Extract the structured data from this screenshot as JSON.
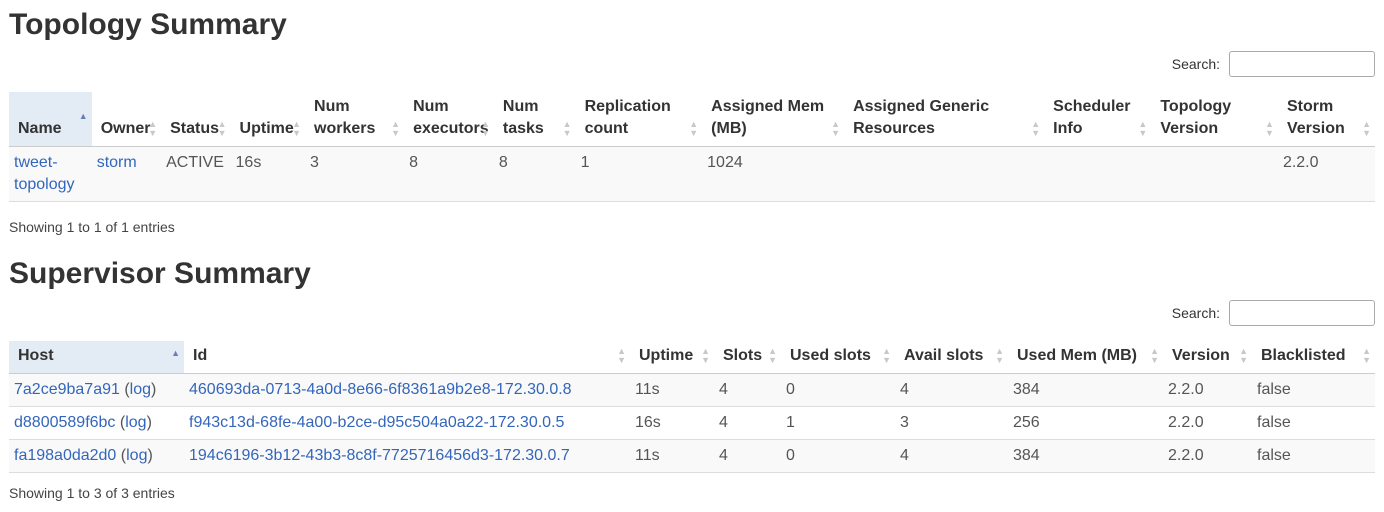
{
  "topology": {
    "title": "Topology Summary",
    "search_label": "Search:",
    "columns": [
      {
        "label": "Name"
      },
      {
        "label": "Owner"
      },
      {
        "label": "Status"
      },
      {
        "label": "Uptime"
      },
      {
        "label": "Num workers"
      },
      {
        "label": "Num executors"
      },
      {
        "label": "Num tasks"
      },
      {
        "label": "Replication count"
      },
      {
        "label": "Assigned Mem (MB)"
      },
      {
        "label": "Assigned Generic Resources"
      },
      {
        "label": "Scheduler Info"
      },
      {
        "label": "Topology Version"
      },
      {
        "label": "Storm Version"
      }
    ],
    "rows": [
      {
        "name": "tweet-topology",
        "owner": "storm",
        "status": "ACTIVE",
        "uptime": "16s",
        "num_workers": "3",
        "num_executors": "8",
        "num_tasks": "8",
        "replication_count": "1",
        "assigned_mem": "1024",
        "assigned_generic_resources": "",
        "scheduler_info": "",
        "topology_version": "",
        "storm_version": "2.2.0"
      }
    ],
    "showing": "Showing 1 to 1 of 1 entries"
  },
  "supervisor": {
    "title": "Supervisor Summary",
    "search_label": "Search:",
    "columns": [
      {
        "label": "Host"
      },
      {
        "label": "Id"
      },
      {
        "label": "Uptime"
      },
      {
        "label": "Slots"
      },
      {
        "label": "Used slots"
      },
      {
        "label": "Avail slots"
      },
      {
        "label": "Used Mem (MB)"
      },
      {
        "label": "Version"
      },
      {
        "label": "Blacklisted"
      }
    ],
    "log_label": "log",
    "rows": [
      {
        "host": "7a2ce9ba7a91",
        "id": "460693da-0713-4a0d-8e66-6f8361a9b2e8-172.30.0.8",
        "uptime": "11s",
        "slots": "4",
        "used_slots": "0",
        "avail_slots": "4",
        "used_mem": "384",
        "version": "2.2.0",
        "blacklisted": "false"
      },
      {
        "host": "d8800589f6bc",
        "id": "f943c13d-68fe-4a00-b2ce-d95c504a0a22-172.30.0.5",
        "uptime": "16s",
        "slots": "4",
        "used_slots": "1",
        "avail_slots": "3",
        "used_mem": "256",
        "version": "2.2.0",
        "blacklisted": "false"
      },
      {
        "host": "fa198a0da2d0",
        "id": "194c6196-3b12-43b3-8c8f-7725716456d3-172.30.0.7",
        "uptime": "11s",
        "slots": "4",
        "used_slots": "0",
        "avail_slots": "4",
        "used_mem": "384",
        "version": "2.2.0",
        "blacklisted": "false"
      }
    ],
    "showing": "Showing 1 to 3 of 3 entries"
  }
}
